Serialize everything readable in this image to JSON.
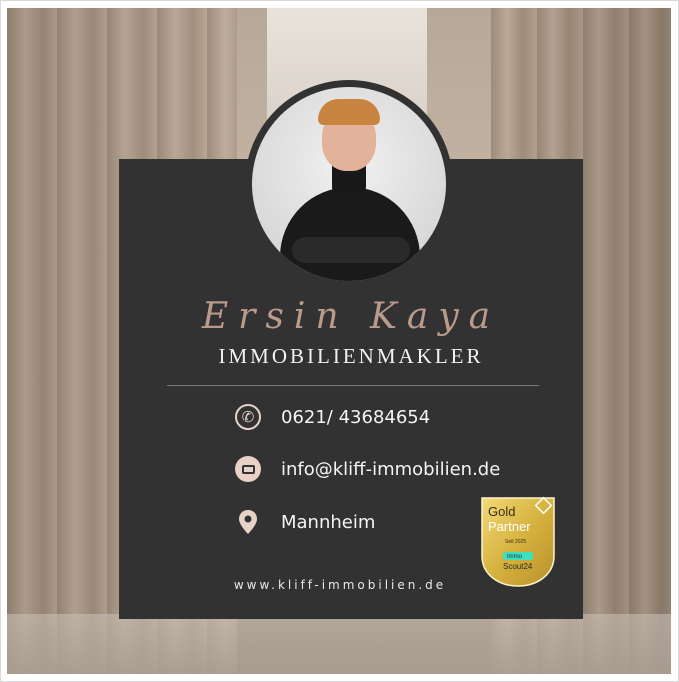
{
  "card": {
    "name": "Ersin Kaya",
    "title": "IMMOBILIENMAKLER",
    "website": "www.kliff-immobilien.de"
  },
  "contacts": [
    {
      "icon": "phone-icon",
      "text": "0621/ 43684654"
    },
    {
      "icon": "mail-icon",
      "text": "info@kliff-immobilien.de"
    },
    {
      "icon": "location-pin-icon",
      "text": "Mannheim"
    }
  ],
  "badge": {
    "line1": "Gold",
    "line2": "Partner",
    "since": "Seit 2025",
    "brand_top": "Immo",
    "brand_bottom": "Scout24"
  },
  "colors": {
    "card": "#333232",
    "accent": "#e8d2c8",
    "name": "#b99a8b",
    "gold": "#d6b23f"
  }
}
